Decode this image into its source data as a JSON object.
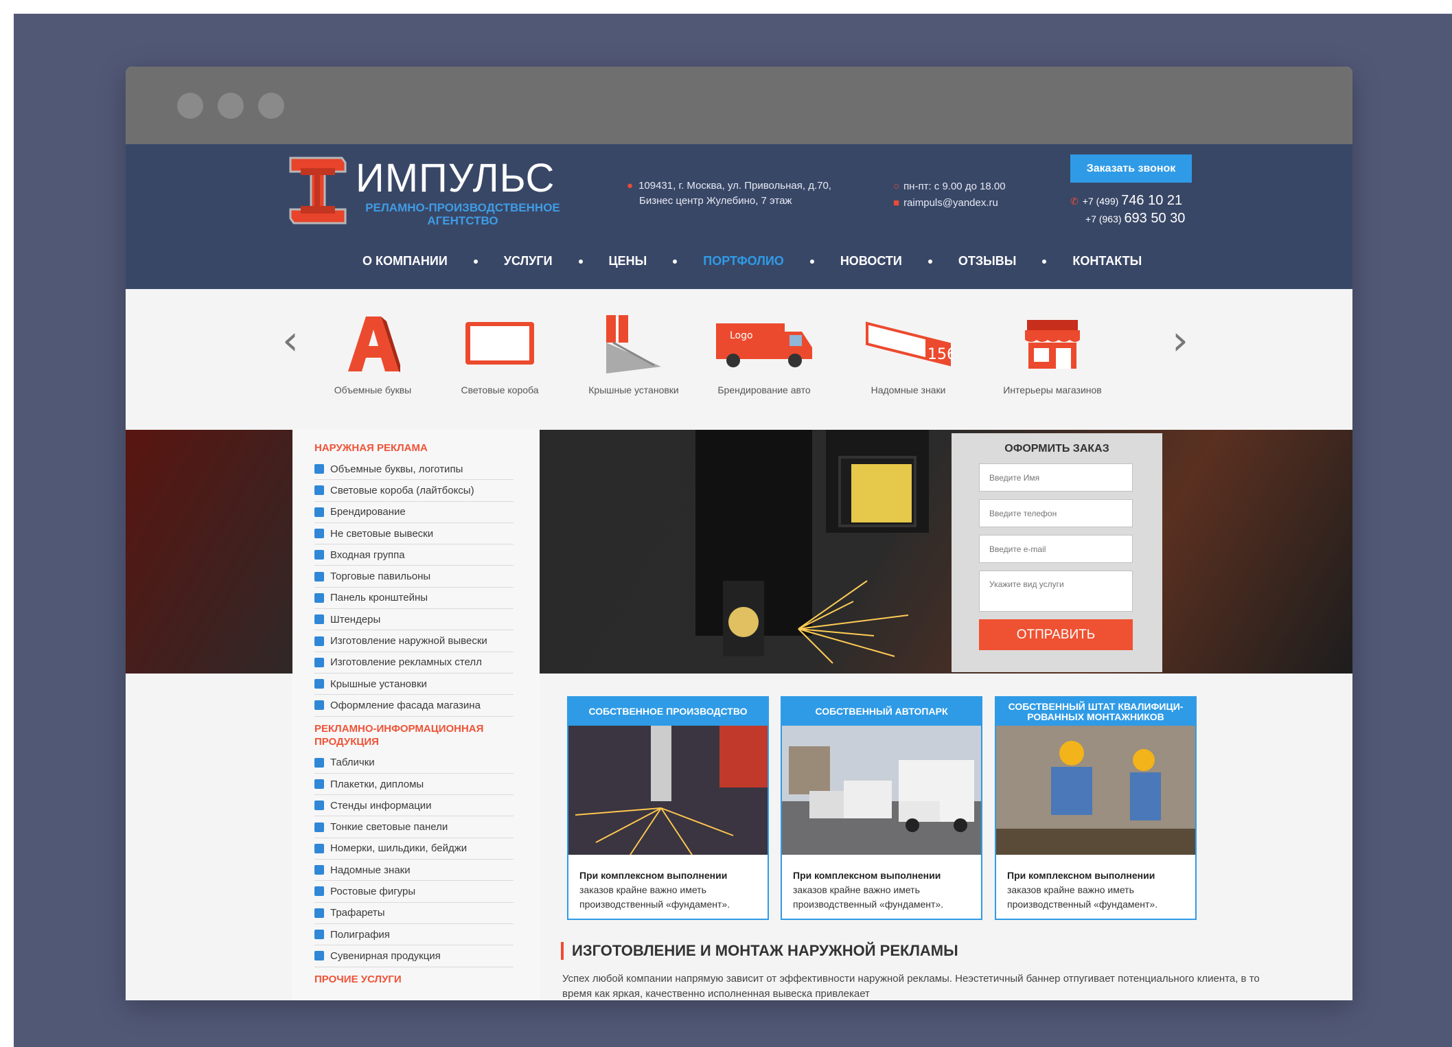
{
  "header": {
    "brand": "ИМПУЛЬС",
    "tagline": "РЕЛАМНО-ПРОИЗВОДСТВЕННОЕ АГЕНТСТВО",
    "address_line1": "109431, г. Москва, ул. Привольная, д.70,",
    "address_line2": "Бизнес центр Жулебино, 7 этаж",
    "hours": "пн-пт: с 9.00 до 18.00",
    "email": "raimpuls@yandex.ru",
    "call_button": "Заказать звонок",
    "phone1_code": "+7 (499)",
    "phone1_number": "746 10 21",
    "phone2_code": "+7 (963)",
    "phone2_number": "693 50 30"
  },
  "nav": [
    "О компании",
    "Услуги",
    "Цены",
    "Портфолио",
    "Новости",
    "Отзывы",
    "Контакты"
  ],
  "categories": [
    {
      "label": "Объемные буквы",
      "icon": "letter-a-icon"
    },
    {
      "label": "Световые короба",
      "icon": "lightbox-icon"
    },
    {
      "label": "Крышные установки",
      "icon": "roof-sign-icon"
    },
    {
      "label": "Брендирование авто",
      "icon": "van-icon"
    },
    {
      "label": "Надомные знаки",
      "icon": "house-number-icon"
    },
    {
      "label": "Интерьеры магазинов",
      "icon": "shop-icon"
    }
  ],
  "sidebar": {
    "h1": "Наружная реклама",
    "items1": [
      "Объемные буквы, логотипы",
      "Световые короба (лайтбоксы)",
      "Брендирование",
      "Не световые вывески",
      "Входная группа",
      "Торговые павильоны",
      "Панель кронштейны",
      "Штендеры",
      "Изготовление наружной вывески",
      "Изготовление рекламных стелл",
      "Крышные установки",
      "Оформление фасада магазина"
    ],
    "h2": "Рекламно-информационная продукция",
    "items2": [
      "Таблички",
      "Плакетки, дипломы",
      "Стенды информации",
      "Тонкие световые панели",
      "Номерки, шильдики, бейджи",
      "Надомные знаки",
      "Ростовые фигуры",
      "Трафареты",
      "Полиграфия",
      "Сувенирная продукция"
    ],
    "h3": "Прочие услуги"
  },
  "order_form": {
    "title": "ОФОРМИТЬ ЗАКАЗ",
    "name_placeholder": "Введите Имя",
    "phone_placeholder": "Введите телефон",
    "email_placeholder": "Введите e-mail",
    "service_placeholder": "Укажите вид услуги",
    "submit": "ОТПРАВИТЬ"
  },
  "cards": [
    {
      "title": "Собственное производство",
      "text_bold": "При комплексном выполнении",
      "text": "заказов крайне важно иметь производственный «фундамент»."
    },
    {
      "title": "Собственный автопарк",
      "text_bold": "При комплексном выполнении",
      "text": "заказов крайне важно иметь производственный «фундамент»."
    },
    {
      "title": "Собственный штат квалифици-рованных монтажников",
      "text_bold": "При комплексном выполнении",
      "text": "заказов крайне важно иметь производственный «фундамент»."
    }
  ],
  "section": {
    "title": "ИЗГОТОВЛЕНИЕ И МОНТАЖ НАРУЖНОЙ РЕКЛАМЫ",
    "text": "Успех любой компании напрямую зависит от эффективности наружной рекламы. Неэстетичный баннер отпугивает потенциального клиента, в то время как яркая, качественно исполненная вывеска привлекает"
  },
  "colors": {
    "background": "#515876",
    "header": "#394767",
    "accent_blue": "#2f9be6",
    "accent_red": "#ef5232"
  }
}
